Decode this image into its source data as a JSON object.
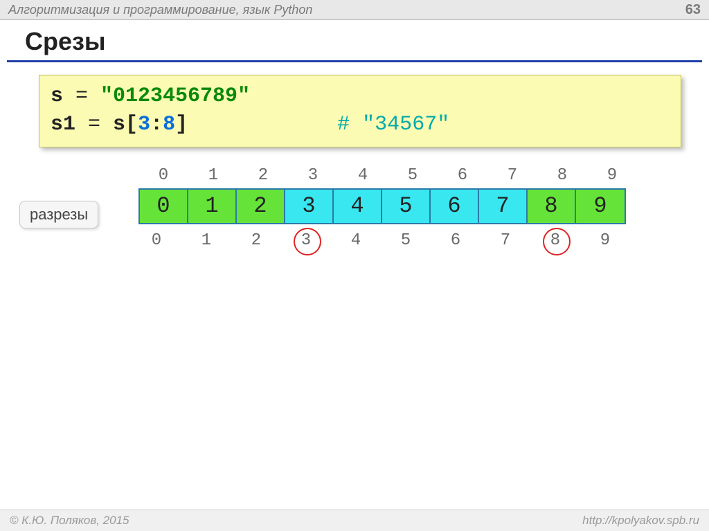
{
  "header": {
    "title": "Алгоритмизация и программирование, язык Python",
    "page": "63"
  },
  "slide_title": "Срезы",
  "code": {
    "line1_var": "s",
    "line1_eq": " = ",
    "line1_str": "\"0123456789\"",
    "line2_var": "s1",
    "line2_eq": " = ",
    "line2_slice_s": "s",
    "line2_slice_open": "[",
    "line2_slice_a": "3",
    "line2_slice_colon": ":",
    "line2_slice_b": "8",
    "line2_slice_close": "]",
    "line2_comment_pad": "            ",
    "line2_comment": "# \"34567\""
  },
  "diagram": {
    "cuts_label": "разрезы",
    "top_indices": [
      "0",
      "1",
      "2",
      "3",
      "4",
      "5",
      "6",
      "7",
      "8",
      "9"
    ],
    "cells": [
      "0",
      "1",
      "2",
      "3",
      "4",
      "5",
      "6",
      "7",
      "8",
      "9"
    ],
    "cell_colors": [
      "green",
      "green",
      "green",
      "cyan",
      "cyan",
      "cyan",
      "cyan",
      "cyan",
      "green",
      "green"
    ],
    "bottom_indices": [
      "0",
      "1",
      "2",
      "3",
      "4",
      "5",
      "6",
      "7",
      "8",
      "9"
    ],
    "circled_bottom": [
      3,
      8
    ]
  },
  "footer": {
    "left": "© К.Ю. Поляков, 2015",
    "right": "http://kpolyakov.spb.ru"
  }
}
